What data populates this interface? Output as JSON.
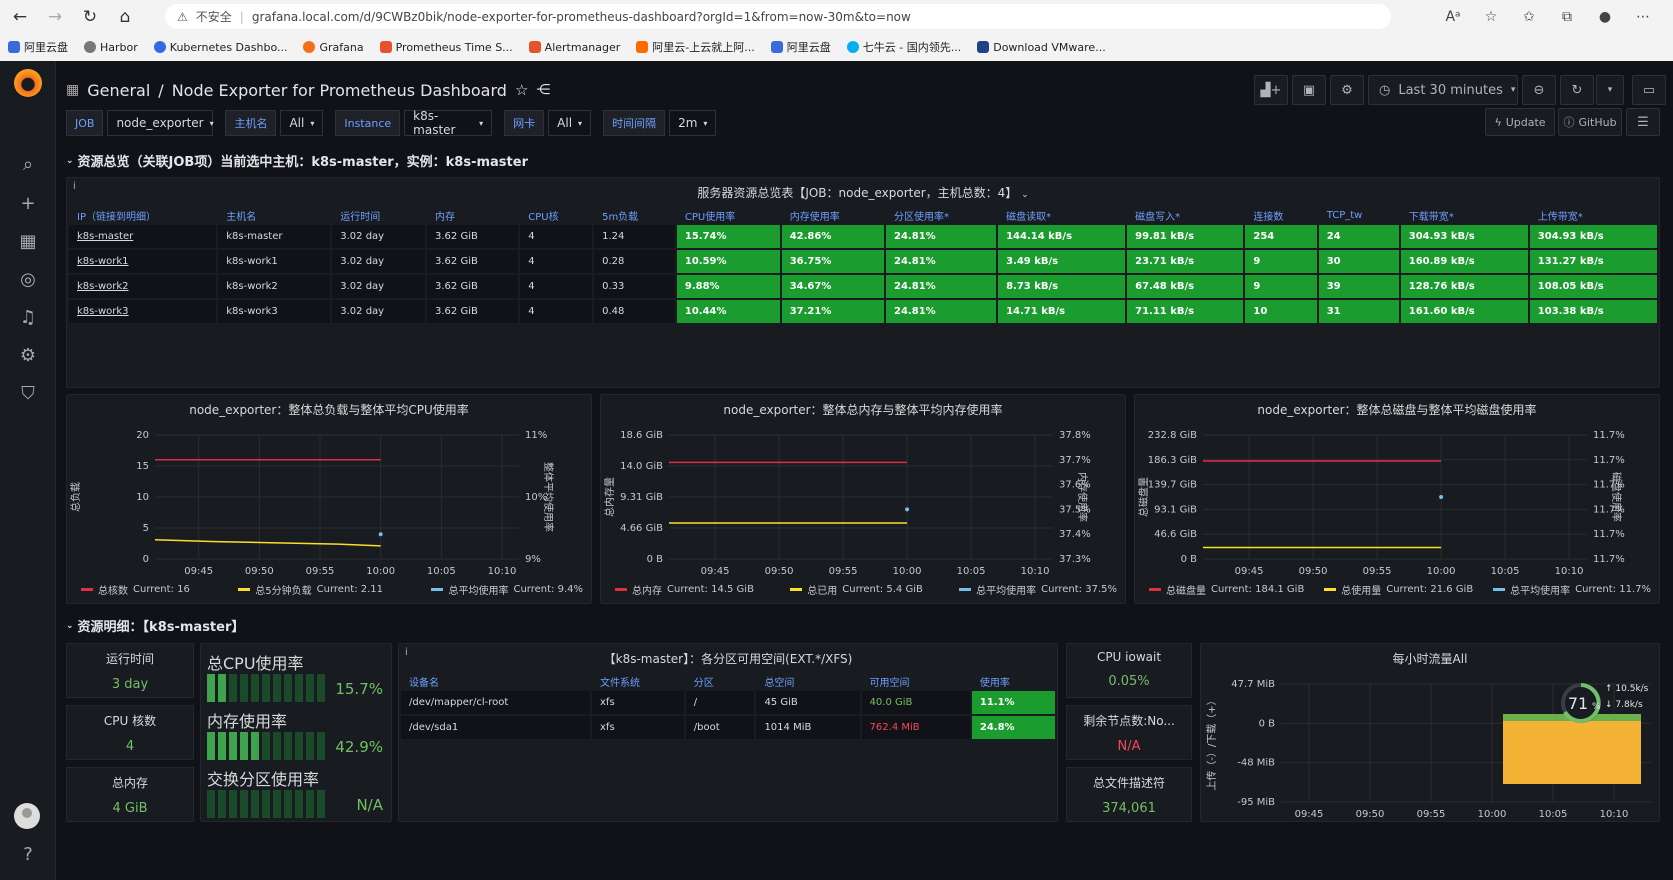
{
  "browser": {
    "insecure": "不安全",
    "url": "grafana.local.com/d/9CWBz0bik/node-exporter-for-prometheus-dashboard?orgId=1&from=now-30m&to=now",
    "bookmarks": [
      "阿里云盘",
      "Harbor",
      "Kubernetes Dashbo...",
      "Grafana",
      "Prometheus Time S...",
      "Alertmanager",
      "阿里云-上云就上阿...",
      "阿里云盘",
      "七牛云 - 国内领先...",
      "Download VMware..."
    ]
  },
  "header": {
    "folder": "General",
    "sep": "/",
    "title": "Node Exporter for Prometheus Dashboard",
    "time_range": "Last 30 minutes",
    "update": "Update",
    "github": "GitHub"
  },
  "vars": [
    {
      "label": "JOB",
      "value": "node_exporter"
    },
    {
      "label": "主机名",
      "value": "All"
    },
    {
      "label": "Instance",
      "value": "k8s-master"
    },
    {
      "label": "网卡",
      "value": "All"
    },
    {
      "label": "时间间隔",
      "value": "2m"
    }
  ],
  "row1": {
    "title": "资源总览（关联JOB项）当前选中主机：k8s-master，实例：k8s-master"
  },
  "summary": {
    "title": "服务器资源总览表【JOB：node_exporter，主机总数：4】",
    "columns": [
      "IP（链接到明细）",
      "主机名",
      "运行时间",
      "内存",
      "CPU核",
      "5m负载",
      "CPU使用率",
      "内存使用率",
      "分区使用率*",
      "磁盘读取*",
      "磁盘写入*",
      "连接数",
      "TCP_tw",
      "下载带宽*",
      "上传带宽*"
    ],
    "rows": [
      [
        "k8s-master",
        "k8s-master",
        "3.02 day",
        "3.62 GiB",
        "4",
        "1.24",
        "15.74%",
        "42.86%",
        "24.81%",
        "144.14 kB/s",
        "99.81 kB/s",
        "254",
        "24",
        "304.93 kB/s",
        "304.93 kB/s"
      ],
      [
        "k8s-work1",
        "k8s-work1",
        "3.02 day",
        "3.62 GiB",
        "4",
        "0.28",
        "10.59%",
        "36.75%",
        "24.81%",
        "3.49 kB/s",
        "23.71 kB/s",
        "9",
        "30",
        "160.89 kB/s",
        "131.27 kB/s"
      ],
      [
        "k8s-work2",
        "k8s-work2",
        "3.02 day",
        "3.62 GiB",
        "4",
        "0.33",
        "9.88%",
        "34.67%",
        "24.81%",
        "8.73 kB/s",
        "67.48 kB/s",
        "9",
        "39",
        "128.76 kB/s",
        "108.05 kB/s"
      ],
      [
        "k8s-work3",
        "k8s-work3",
        "3.02 day",
        "3.62 GiB",
        "4",
        "0.48",
        "10.44%",
        "37.21%",
        "24.81%",
        "14.71 kB/s",
        "71.11 kB/s",
        "10",
        "31",
        "161.60 kB/s",
        "103.38 kB/s"
      ]
    ]
  },
  "chart_data": [
    {
      "type": "line",
      "title": "node_exporter：整体总负载与整体平均CPU使用率",
      "x": [
        "09:45",
        "09:50",
        "09:55",
        "10:00",
        "10:05",
        "10:10"
      ],
      "ylabel": "总负载",
      "y2label": "整体平均使用率",
      "yticks": [
        "20",
        "15",
        "10",
        "5",
        "0"
      ],
      "y2ticks": [
        "11%",
        "10%",
        "9%"
      ],
      "ylim": [
        0,
        20
      ],
      "y2lim": [
        9,
        11
      ],
      "series": [
        {
          "name": "总核数",
          "current": "Current: 16",
          "color": "#e02f44",
          "axis": "left",
          "points": [
            [
              0,
              16
            ],
            [
              1.85,
              16
            ]
          ]
        },
        {
          "name": "总5分钟负载",
          "current": "Current: 2.11",
          "color": "#fade2a",
          "axis": "left",
          "points": [
            [
              0,
              3.1
            ],
            [
              0.5,
              2.8
            ],
            [
              1,
              2.6
            ],
            [
              1.5,
              2.4
            ],
            [
              1.85,
              2.11
            ]
          ]
        },
        {
          "name": "总平均使用率",
          "current": "Current: 9.4%",
          "color": "#73bfea",
          "axis": "right",
          "points": [
            [
              1.85,
              9.4
            ]
          ]
        }
      ]
    },
    {
      "type": "line",
      "title": "node_exporter：整体总内存与整体平均内存使用率",
      "x": [
        "09:45",
        "09:50",
        "09:55",
        "10:00",
        "10:05",
        "10:10"
      ],
      "ylabel": "总内存量",
      "y2label": "内存使用率",
      "yticks": [
        "18.6 GiB",
        "14.0 GiB",
        "9.31 GiB",
        "4.66 GiB",
        "0 B"
      ],
      "y2ticks": [
        "37.8%",
        "37.7%",
        "37.6%",
        "37.5%",
        "37.4%",
        "37.3%"
      ],
      "ylim": [
        0,
        18.6
      ],
      "y2lim": [
        37.3,
        37.8
      ],
      "series": [
        {
          "name": "总内存",
          "current": "Current: 14.5 GiB",
          "color": "#e02f44",
          "axis": "left",
          "points": [
            [
              0,
              14.5
            ],
            [
              1.85,
              14.5
            ]
          ]
        },
        {
          "name": "总已用",
          "current": "Current: 5.4 GiB",
          "color": "#fade2a",
          "axis": "left",
          "points": [
            [
              0,
              5.4
            ],
            [
              1.85,
              5.4
            ]
          ]
        },
        {
          "name": "总平均使用率",
          "current": "Current: 37.5%",
          "color": "#73bfea",
          "axis": "right",
          "points": [
            [
              1.85,
              37.5
            ]
          ]
        }
      ]
    },
    {
      "type": "line",
      "title": "node_exporter：整体总磁盘与整体平均磁盘使用率",
      "x": [
        "09:45",
        "09:50",
        "09:55",
        "10:00",
        "10:05",
        "10:10"
      ],
      "ylabel": "总磁盘量",
      "y2label": "磁盘使用率",
      "yticks": [
        "232.8 GiB",
        "186.3 GiB",
        "139.7 GiB",
        "93.1 GiB",
        "46.6 GiB",
        "0 B"
      ],
      "y2ticks": [
        "11.7%",
        "11.7%",
        "11.7%",
        "11.7%",
        "11.7%",
        "11.7%"
      ],
      "ylim": [
        0,
        232.8
      ],
      "y2lim": [
        0,
        1
      ],
      "series": [
        {
          "name": "总磁盘量",
          "current": "Current: 184.1 GiB",
          "color": "#e02f44",
          "axis": "left",
          "points": [
            [
              0,
              184.1
            ],
            [
              1.85,
              184.1
            ]
          ]
        },
        {
          "name": "总使用量",
          "current": "Current: 21.6 GiB",
          "color": "#fade2a",
          "axis": "left",
          "points": [
            [
              0,
              21.6
            ],
            [
              1.85,
              21.6
            ]
          ]
        },
        {
          "name": "总平均使用率",
          "current": "Current: 11.7%",
          "color": "#73bfea",
          "axis": "right",
          "points": [
            [
              1.85,
              0.5
            ]
          ]
        }
      ]
    }
  ],
  "row2": {
    "title": "资源明细：【k8s-master】"
  },
  "stats": [
    {
      "title": "运行时间",
      "value": "3 day",
      "color": "#73bf69"
    },
    {
      "title": "CPU 核数",
      "value": "4",
      "color": "#73bf69"
    },
    {
      "title": "总内存",
      "value": "4 GiB",
      "color": "#73bf69"
    }
  ],
  "gauges": [
    {
      "title": "总CPU使用率",
      "value": "15.7%",
      "fraction": 0.157
    },
    {
      "title": "内存使用率",
      "value": "42.9%",
      "fraction": 0.429
    },
    {
      "title": "交换分区使用率",
      "value": "N/A",
      "fraction": 0
    }
  ],
  "fs": {
    "title": "【k8s-master】：各分区可用空间(EXT.*/XFS)",
    "columns": [
      "设备名",
      "文件系统",
      "分区",
      "总空间",
      "可用空间",
      "使用率"
    ],
    "rows": [
      [
        "/dev/mapper/cl-root",
        "xfs",
        "/",
        "45 GiB",
        "40.0 GiB",
        "11.1%"
      ],
      [
        "/dev/sda1",
        "xfs",
        "/boot",
        "1014 MiB",
        "762.4 MiB",
        "24.8%"
      ]
    ]
  },
  "stats2": [
    {
      "title": "CPU iowait",
      "value": "0.05%",
      "color": "#73bf69"
    },
    {
      "title": "剩余节点数:No...",
      "value": "N/A",
      "color": "#f2495c"
    },
    {
      "title": "总文件描述符",
      "value": "374,061",
      "color": "#73bf69"
    }
  ],
  "traffic": {
    "title": "每小时流量All",
    "ylabel": "上传（-）/下载（+）",
    "yticks": [
      "47.7 MiB",
      "0 B",
      "-48 MiB",
      "-95 MiB"
    ],
    "x": [
      "09:45",
      "09:50",
      "09:55",
      "10:00",
      "10:05",
      "10:10"
    ],
    "gauge_value": "71",
    "gauge_unit": "%",
    "up": "10.5",
    "down": "7.8",
    "rate_unit": "k/s"
  }
}
